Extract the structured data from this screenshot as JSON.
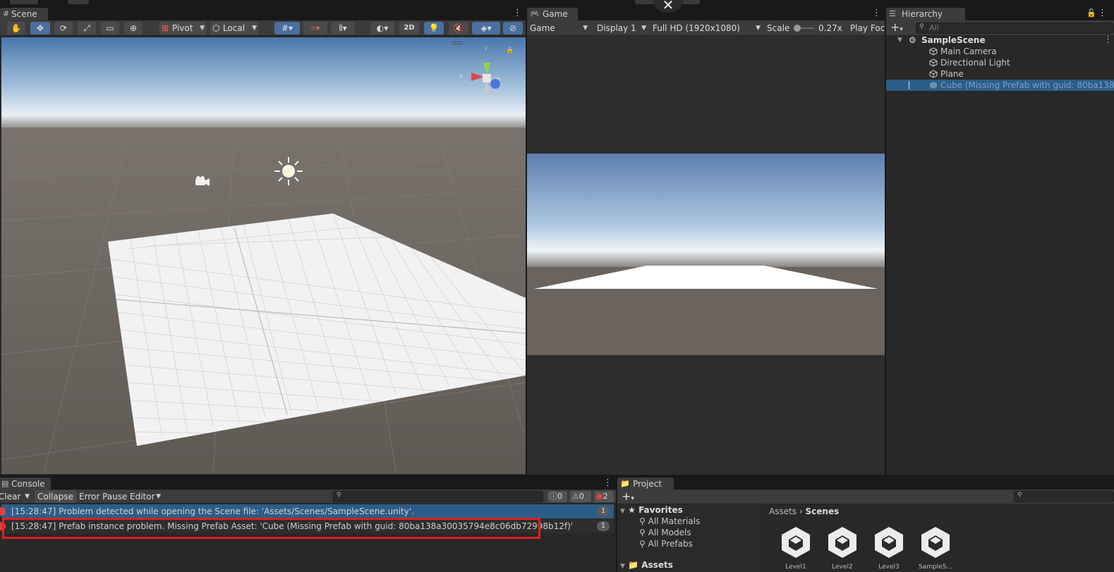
{
  "scene": {
    "tab_label": "Scene",
    "pivot_label": "Pivot",
    "local_label": "Local",
    "two_d_label": "2D",
    "persp_label": "Persp",
    "gizmo_labels": {
      "y": "y",
      "x": "x"
    }
  },
  "game": {
    "tab_label": "Game",
    "mode_label": "Game",
    "display_label": "Display 1",
    "resolution_label": "Full HD (1920x1080)",
    "scale_label": "Scale",
    "scale_value": "0.27x",
    "scale_fraction": 0.05,
    "play_focus_label": "Play Foc"
  },
  "hierarchy": {
    "tab_label": "Hierarchy",
    "search_placeholder": "All",
    "scene_name": "SampleScene",
    "items": [
      {
        "label": "Main Camera",
        "icon": "cube-outline-icon"
      },
      {
        "label": "Directional Light",
        "icon": "cube-outline-icon"
      },
      {
        "label": "Plane",
        "icon": "cube-outline-icon"
      },
      {
        "label": "Cube (Missing Prefab with guid: 80ba138a",
        "icon": "missing-prefab-icon",
        "selected": true
      }
    ]
  },
  "console": {
    "tab_label": "Console",
    "clear_label": "Clear",
    "collapse_label": "Collapse",
    "error_pause_label": "Error Pause",
    "editor_label": "Editor",
    "info_count": "0",
    "warn_count": "0",
    "error_count": "2",
    "messages": [
      {
        "text": "[15:28:47] Problem detected while opening the Scene file: 'Assets/Scenes/SampleScene.unity'.",
        "count": "1",
        "selected": true
      },
      {
        "text": "[15:28:47] Prefab instance problem. Missing Prefab Asset: 'Cube (Missing Prefab with guid: 80ba138a30035794e8c06db72998b12f)'",
        "count": "1",
        "highlighted": true
      }
    ]
  },
  "project": {
    "tab_label": "Project",
    "favorites_label": "Favorites",
    "favorites": [
      "All Materials",
      "All Models",
      "All Prefabs"
    ],
    "assets_label": "Assets",
    "breadcrumb": [
      "Assets",
      "Scenes"
    ],
    "asset_tiles": [
      "Level1",
      "Level2",
      "Level3",
      "SampleS..."
    ]
  },
  "colors": {
    "accent": "#2c5d87",
    "error": "#e04040",
    "highlight_box": "#e02020",
    "sky_top": "#3e6aa3",
    "ground": "#6b645e"
  }
}
